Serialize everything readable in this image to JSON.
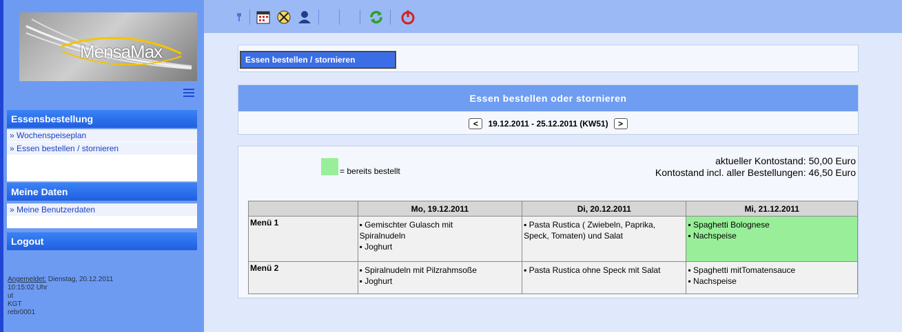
{
  "app": {
    "logo_text": "MensaMax"
  },
  "sidebar": {
    "sections": [
      {
        "title": "Essensbestellung",
        "items": [
          "» Wochenspeiseplan",
          "» Essen bestellen / stornieren"
        ]
      },
      {
        "title": "Meine Daten",
        "items": [
          "» Meine Benutzerdaten"
        ]
      },
      {
        "title": "Logout",
        "items": []
      }
    ],
    "login": {
      "label": "Angemeldet:",
      "datetime": " Dienstag, 20.12.2011",
      "time": "10:15:02 Uhr",
      "line3": "ut",
      "line4": "KGT",
      "user": "rebr0001"
    }
  },
  "toolbar": {
    "icons": [
      "pin-icon",
      "calendar-icon",
      "cutlery-icon",
      "user-icon",
      "refresh-icon",
      "power-icon"
    ]
  },
  "tabs": {
    "active": "Essen bestellen / stornieren"
  },
  "header": {
    "title": "Essen bestellen oder stornieren",
    "week": "19.12.2011 - 25.12.2011 (KW51)",
    "prev": "<",
    "next": ">"
  },
  "legend": {
    "text": "= bereits bestellt",
    "color": "#99ef99"
  },
  "account": {
    "current": "aktueller Kontostand: 50,00 Euro",
    "incl": "Kontostand incl. aller Bestellungen: 46,50 Euro"
  },
  "menu": {
    "days": [
      "Mo, 19.12.2011",
      "Di, 20.12.2011",
      "Mi, 21.12.2011"
    ],
    "rows": [
      {
        "name": "Menü 1",
        "cells": [
          {
            "ordered": false,
            "dishes": [
              "▪ Gemischter Gulasch mit",
              "Spiralnudeln",
              "▪ Joghurt"
            ]
          },
          {
            "ordered": false,
            "dishes": [
              "▪ Pasta Rustica ( Zwiebeln, Paprika,",
              "Speck, Tomaten) und Salat"
            ]
          },
          {
            "ordered": true,
            "dishes": [
              "▪ Spaghetti Bolognese",
              "▪ Nachspeise"
            ]
          }
        ]
      },
      {
        "name": "Menü 2",
        "cells": [
          {
            "ordered": false,
            "dishes": [
              "▪ Spiralnudeln mit Pilzrahmsoße",
              "▪ Joghurt"
            ]
          },
          {
            "ordered": false,
            "dishes": [
              "▪ Pasta Rustica ohne Speck mit Salat"
            ]
          },
          {
            "ordered": false,
            "dishes": [
              "▪ Spaghetti mitTomatensauce",
              "▪ Nachspeise"
            ]
          }
        ]
      }
    ]
  }
}
